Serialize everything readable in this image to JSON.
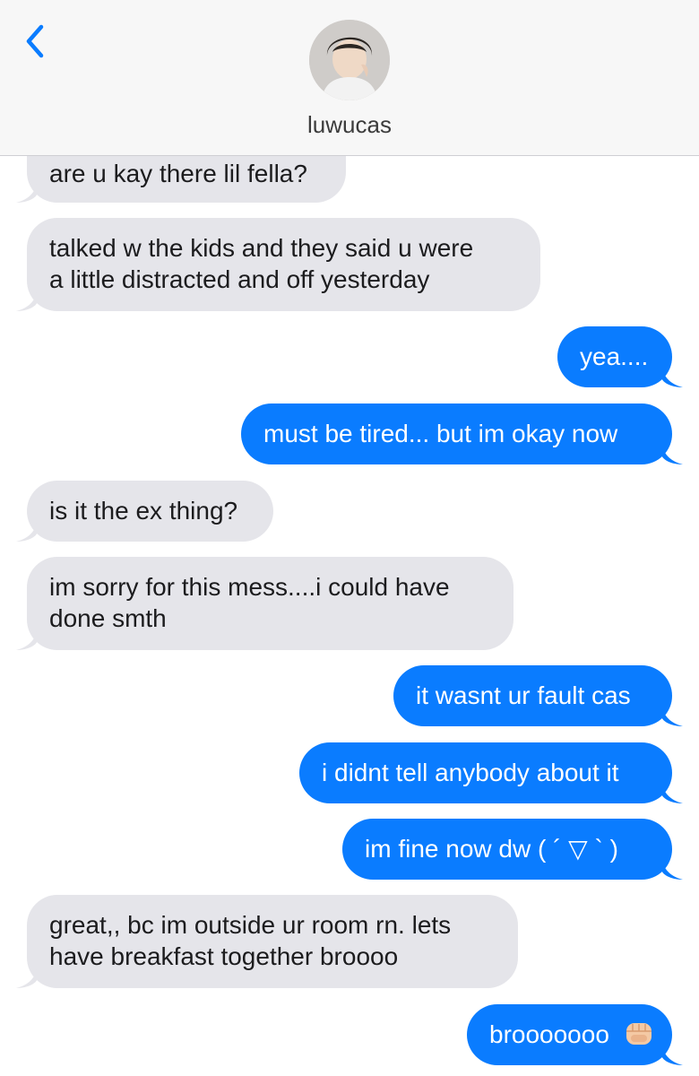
{
  "header": {
    "contact_name": "luwucas",
    "back_icon": "chevron-left-icon",
    "avatar_icon": "contact-avatar"
  },
  "colors": {
    "incoming_bubble": "#e5e5ea",
    "outgoing_bubble": "#0a7cff",
    "accent": "#0a7cff"
  },
  "messages": [
    {
      "from": "them",
      "lines": [
        "are u kay there lil fella?"
      ]
    },
    {
      "from": "them",
      "lines": [
        "talked w the kids and they said u were",
        "a little distracted and off yesterday"
      ]
    },
    {
      "from": "me",
      "lines": [
        "yea...."
      ]
    },
    {
      "from": "me",
      "lines": [
        "must be tired... but im okay now"
      ]
    },
    {
      "from": "them",
      "lines": [
        "is it the ex thing?"
      ]
    },
    {
      "from": "them",
      "lines": [
        "im sorry for this mess....i could have",
        "done smth"
      ]
    },
    {
      "from": "me",
      "lines": [
        "it wasnt ur fault cas"
      ]
    },
    {
      "from": "me",
      "lines": [
        "i didnt tell anybody about it"
      ]
    },
    {
      "from": "me",
      "lines": [
        "im fine now dw ( ´ ▽ ` )"
      ]
    },
    {
      "from": "them",
      "lines": [
        "great,, bc im outside ur room rn. lets",
        "have breakfast together broooo"
      ]
    },
    {
      "from": "me",
      "lines": [
        "brooooooo"
      ],
      "emoji": "fist-bump-emoji"
    }
  ]
}
